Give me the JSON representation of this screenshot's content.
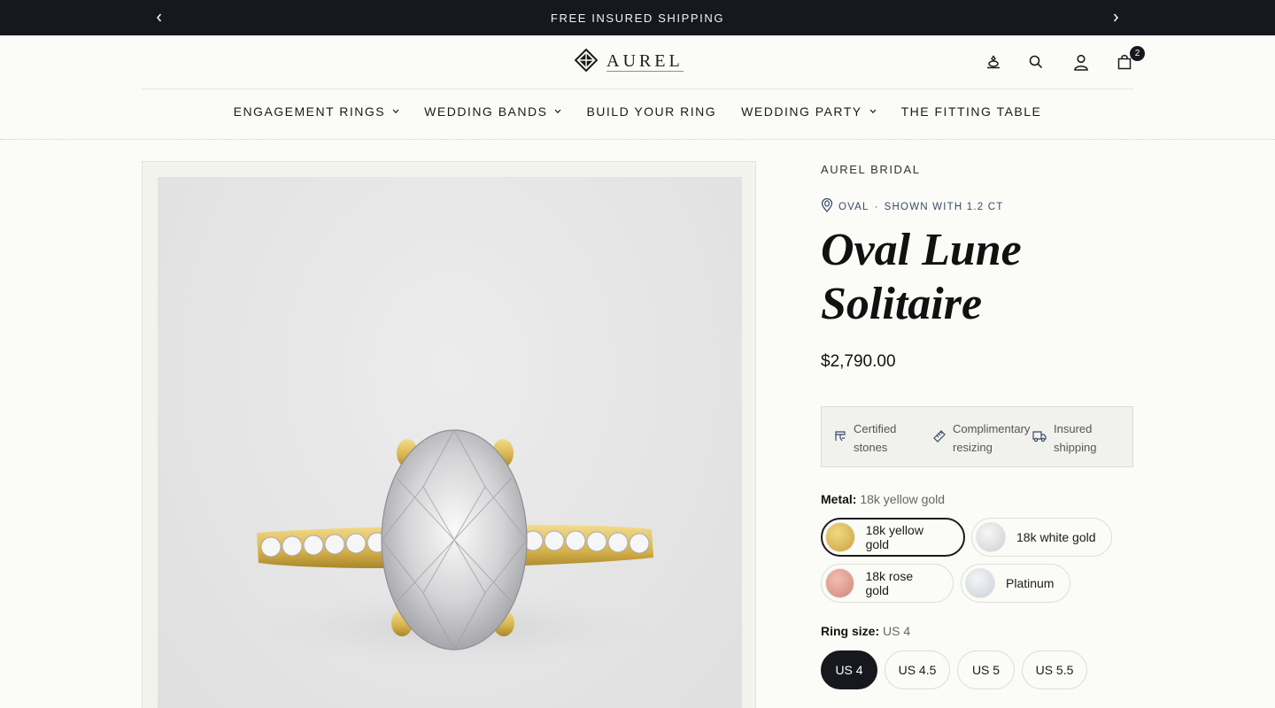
{
  "announcement": {
    "message": "FREE INSURED SHIPPING"
  },
  "header": {
    "logo_text": "AUREL",
    "cart_count": "2"
  },
  "nav": {
    "items": [
      {
        "label": "ENGAGEMENT RINGS",
        "has_dropdown": true
      },
      {
        "label": "WEDDING BANDS",
        "has_dropdown": true
      },
      {
        "label": "BUILD YOUR RING",
        "has_dropdown": false
      },
      {
        "label": "WEDDING PARTY",
        "has_dropdown": true
      },
      {
        "label": "THE FITTING TABLE",
        "has_dropdown": false
      }
    ]
  },
  "product": {
    "brand": "AUREL BRIDAL",
    "shape": "OVAL",
    "separator": "·",
    "shown_with": "SHOWN WITH 1.2 CT",
    "title_line1": "Oval Lune",
    "title_line2": "Solitaire",
    "price": "$2,790.00",
    "perks": [
      {
        "line1": "Certified",
        "line2": "stones",
        "icon": "certificate-icon"
      },
      {
        "line1": "Complimentary",
        "line2": "resizing",
        "icon": "ruler-icon"
      },
      {
        "line1": "Insured",
        "line2": "shipping",
        "icon": "truck-icon"
      }
    ],
    "metal": {
      "label": "Metal:",
      "selected": "18k yellow gold",
      "options": [
        {
          "label": "18k yellow gold",
          "color": "#d9b64a"
        },
        {
          "label": "18k white gold",
          "color": "#e2e2e4"
        },
        {
          "label": "18k rose gold",
          "color": "#e2a192"
        },
        {
          "label": "Platinum",
          "color": "#dfe3e8"
        }
      ]
    },
    "size": {
      "label": "Ring size:",
      "selected": "US 4",
      "options": [
        "US 4",
        "US 4.5",
        "US 5",
        "US 5.5"
      ]
    }
  },
  "colors": {
    "accent_dark": "#16181d",
    "meta_blue": "#3b4a6b",
    "background": "#fbfbf8"
  }
}
